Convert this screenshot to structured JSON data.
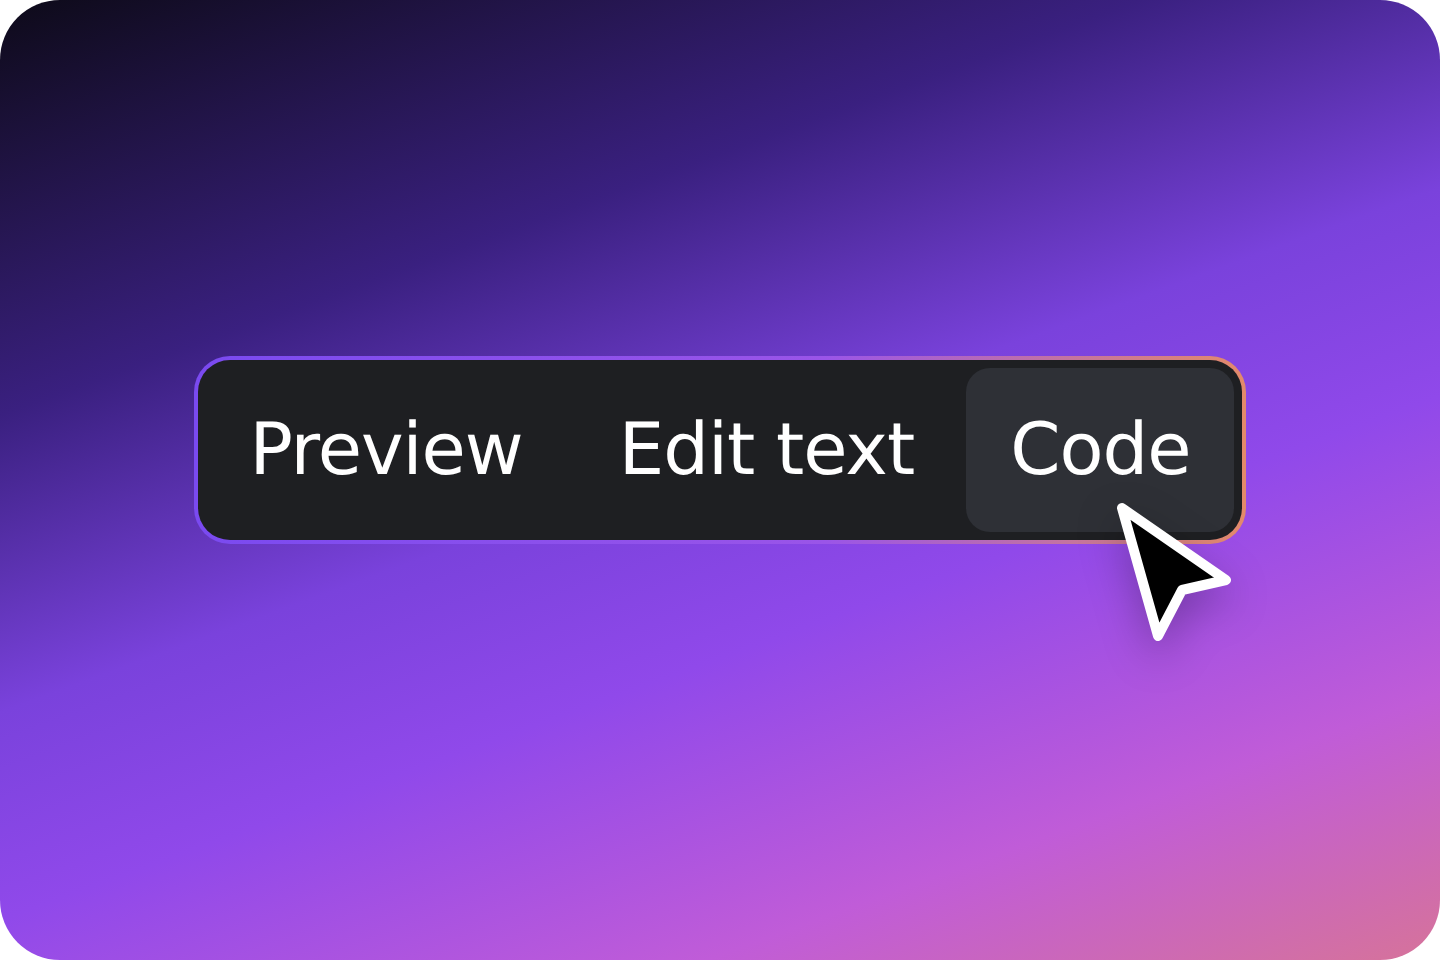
{
  "tabs": [
    {
      "label": "Preview",
      "selected": false
    },
    {
      "label": "Edit text",
      "selected": false
    },
    {
      "label": "Code",
      "selected": true
    }
  ]
}
